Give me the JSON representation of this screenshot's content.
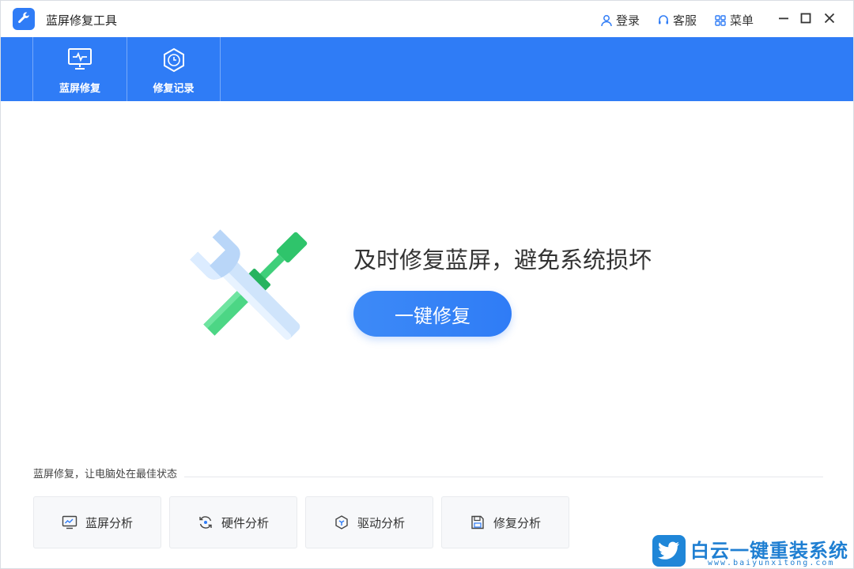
{
  "app": {
    "title": "蓝屏修复工具"
  },
  "titlebar": {
    "login_label": "登录",
    "service_label": "客服",
    "menu_label": "菜单"
  },
  "toolbar": {
    "tabs": [
      {
        "label": "蓝屏修复",
        "icon": "monitor-pulse-icon"
      },
      {
        "label": "修复记录",
        "icon": "clock-hexagon-icon"
      }
    ]
  },
  "hero": {
    "heading": "及时修复蓝屏，避免系统损坏",
    "button_label": "一键修复"
  },
  "bottom": {
    "caption": "蓝屏修复，让电脑处在最佳状态",
    "cards": [
      {
        "label": "蓝屏分析",
        "icon": "chart-monitor-icon"
      },
      {
        "label": "硬件分析",
        "icon": "refresh-cycle-icon"
      },
      {
        "label": "驱动分析",
        "icon": "cube-icon"
      },
      {
        "label": "修复分析",
        "icon": "floppy-disk-icon"
      }
    ]
  },
  "watermark": {
    "brand": "白云一键重装系统",
    "url": "www.baiyunxitong.com"
  },
  "colors": {
    "accent": "#2f7cf6",
    "watermark": "#1f7fd2",
    "green": "#2fc46b"
  }
}
